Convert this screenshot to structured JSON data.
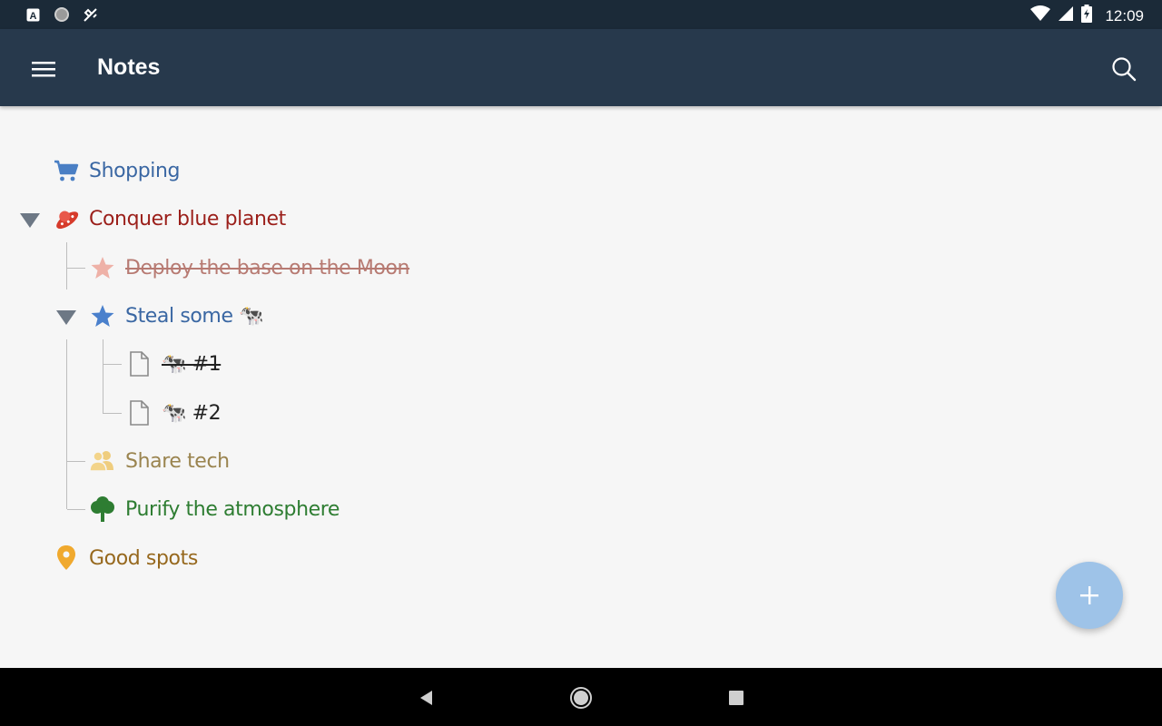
{
  "status_bar": {
    "time": "12:09",
    "left_icons": [
      "app-a-icon",
      "circle-icon",
      "satellite-icon"
    ],
    "right_icons": [
      "wifi-icon",
      "signal-icon",
      "battery-charging-icon"
    ]
  },
  "app_bar": {
    "title": "Notes",
    "menu_icon": "menu-icon",
    "search_icon": "search-icon"
  },
  "tree": {
    "items": [
      {
        "label": "Shopping",
        "icon": "cart-icon",
        "color": "#3a67a3"
      },
      {
        "label": "Conquer blue planet",
        "icon": "ufo-icon",
        "color": "#9b1f1a",
        "expanded": true
      },
      {
        "label": "Deploy the base on the Moon",
        "icon": "star-icon",
        "color": "#b77a72",
        "done": true
      },
      {
        "label": "Steal some 🐄",
        "icon": "star-icon",
        "color": "#3a67a3",
        "expanded": true
      },
      {
        "label": "🐄 #1",
        "icon": "document-icon",
        "color": "#222222",
        "done": true
      },
      {
        "label": "🐄 #2",
        "icon": "document-icon",
        "color": "#222222"
      },
      {
        "label": "Share tech",
        "icon": "people-icon",
        "color": "#9a844f"
      },
      {
        "label": "Purify the atmosphere",
        "icon": "tree-icon",
        "color": "#2e7d32"
      },
      {
        "label": "Good spots",
        "icon": "location-pin-icon",
        "color": "#96681d"
      }
    ]
  },
  "fab": {
    "icon": "plus-icon",
    "color": "#9ec3e8"
  },
  "nav_bar": {
    "icons": [
      "back-icon",
      "home-icon",
      "recents-icon"
    ]
  }
}
